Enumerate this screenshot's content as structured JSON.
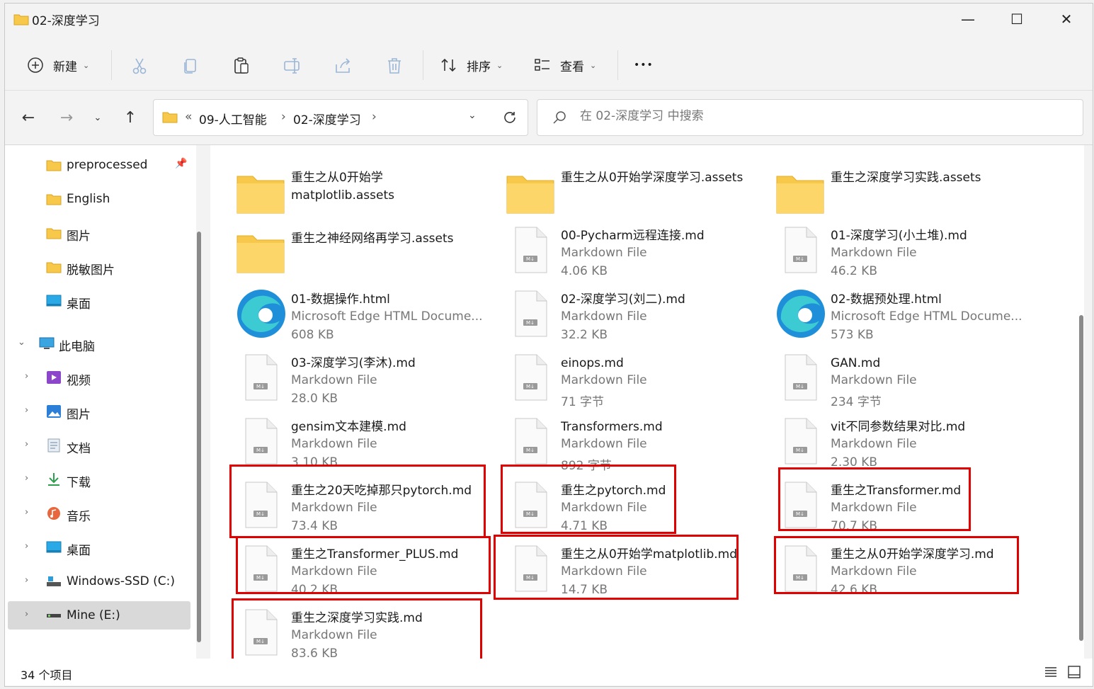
{
  "window": {
    "title": "02-深度学习",
    "minimize_glyph": "—",
    "maximize_glyph": "☐",
    "close_glyph": "✕"
  },
  "toolbar": {
    "new_label": "新建",
    "sort_label": "排序",
    "view_label": "查看",
    "more_glyph": "•••",
    "icons": [
      "plus-circle-icon",
      "cut-icon",
      "copy-icon",
      "paste-icon",
      "rename-icon",
      "share-icon",
      "delete-icon",
      "sort-icon",
      "view-icon"
    ]
  },
  "address": {
    "overflow": "«",
    "crumbs": [
      "09-人工智能",
      "02-深度学习"
    ],
    "separator": "›"
  },
  "search": {
    "placeholder": "在 02-深度学习 中搜索"
  },
  "sidebar": {
    "items": [
      {
        "label": "preprocessed",
        "icon": "folder-icon",
        "pinned": true
      },
      {
        "label": "English",
        "icon": "folder-icon"
      },
      {
        "label": "图片",
        "icon": "folder-icon"
      },
      {
        "label": "脱敏图片",
        "icon": "folder-icon"
      },
      {
        "label": "桌面",
        "icon": "desktop-icon"
      },
      {
        "label": "此电脑",
        "icon": "pc-icon",
        "expanded": true
      },
      {
        "label": "视频",
        "icon": "video-icon"
      },
      {
        "label": "图片",
        "icon": "pictures-icon"
      },
      {
        "label": "文档",
        "icon": "documents-icon"
      },
      {
        "label": "下载",
        "icon": "download-icon"
      },
      {
        "label": "音乐",
        "icon": "music-icon"
      },
      {
        "label": "桌面",
        "icon": "desktop-icon"
      },
      {
        "label": "Windows-SSD (C:)",
        "icon": "drive-icon"
      },
      {
        "label": "Mine (E:)",
        "icon": "drive-icon",
        "selected": true
      }
    ]
  },
  "files": [
    {
      "name": "重生之从0开始学matplotlib.assets",
      "name_line1": "重生之从0开始学",
      "name_line2": "matplotlib.assets",
      "kind": "folder"
    },
    {
      "name": "重生之从0开始学深度学习.assets",
      "kind": "folder"
    },
    {
      "name": "重生之深度学习实践.assets",
      "kind": "folder"
    },
    {
      "name": "重生之神经网络再学习.assets",
      "kind": "folder"
    },
    {
      "name": "00-Pycharm远程连接.md",
      "type": "Markdown File",
      "size": "4.06 KB",
      "kind": "md"
    },
    {
      "name": "01-深度学习(小土堆).md",
      "type": "Markdown File",
      "size": "46.2 KB",
      "kind": "md"
    },
    {
      "name": "01-数据操作.html",
      "type": "Microsoft Edge HTML Docume...",
      "size": "608 KB",
      "kind": "edge"
    },
    {
      "name": "02-深度学习(刘二).md",
      "type": "Markdown File",
      "size": "32.2 KB",
      "kind": "md"
    },
    {
      "name": "02-数据预处理.html",
      "type": "Microsoft Edge HTML Docume...",
      "size": "573 KB",
      "kind": "edge"
    },
    {
      "name": "03-深度学习(李沐).md",
      "type": "Markdown File",
      "size": "28.0 KB",
      "kind": "md"
    },
    {
      "name": "einops.md",
      "type": "Markdown File",
      "size": "71 字节",
      "kind": "md"
    },
    {
      "name": "GAN.md",
      "type": "Markdown File",
      "size": "234 字节",
      "kind": "md"
    },
    {
      "name": "gensim文本建模.md",
      "type": "Markdown File",
      "size": "3.10 KB",
      "kind": "md"
    },
    {
      "name": "Transformers.md",
      "type": "Markdown File",
      "size": "892 字节",
      "kind": "md"
    },
    {
      "name": "vit不同参数结果对比.md",
      "type": "Markdown File",
      "size": "2.30 KB",
      "kind": "md"
    },
    {
      "name": "重生之20天吃掉那只pytorch.md",
      "type": "Markdown File",
      "size": "73.4 KB",
      "kind": "md"
    },
    {
      "name": "重生之pytorch.md",
      "type": "Markdown File",
      "size": "4.71 KB",
      "kind": "md"
    },
    {
      "name": "重生之Transformer.md",
      "type": "Markdown File",
      "size": "70.7 KB",
      "kind": "md"
    },
    {
      "name": "重生之Transformer_PLUS.md",
      "type": "Markdown File",
      "size": "40.2 KB",
      "kind": "md"
    },
    {
      "name": "重生之从0开始学matplotlib.md",
      "type": "Markdown File",
      "size": "14.7 KB",
      "kind": "md"
    },
    {
      "name": "重生之从0开始学深度学习.md",
      "type": "Markdown File",
      "size": "42.6 KB",
      "kind": "md"
    },
    {
      "name": "重生之深度学习实践.md",
      "type": "Markdown File",
      "size": "83.6 KB",
      "kind": "md"
    }
  ],
  "status": {
    "count": "34 个项目"
  },
  "colors": {
    "highlight": "#e00000",
    "folder": "#f8c84a",
    "accent": "#0067c0"
  }
}
